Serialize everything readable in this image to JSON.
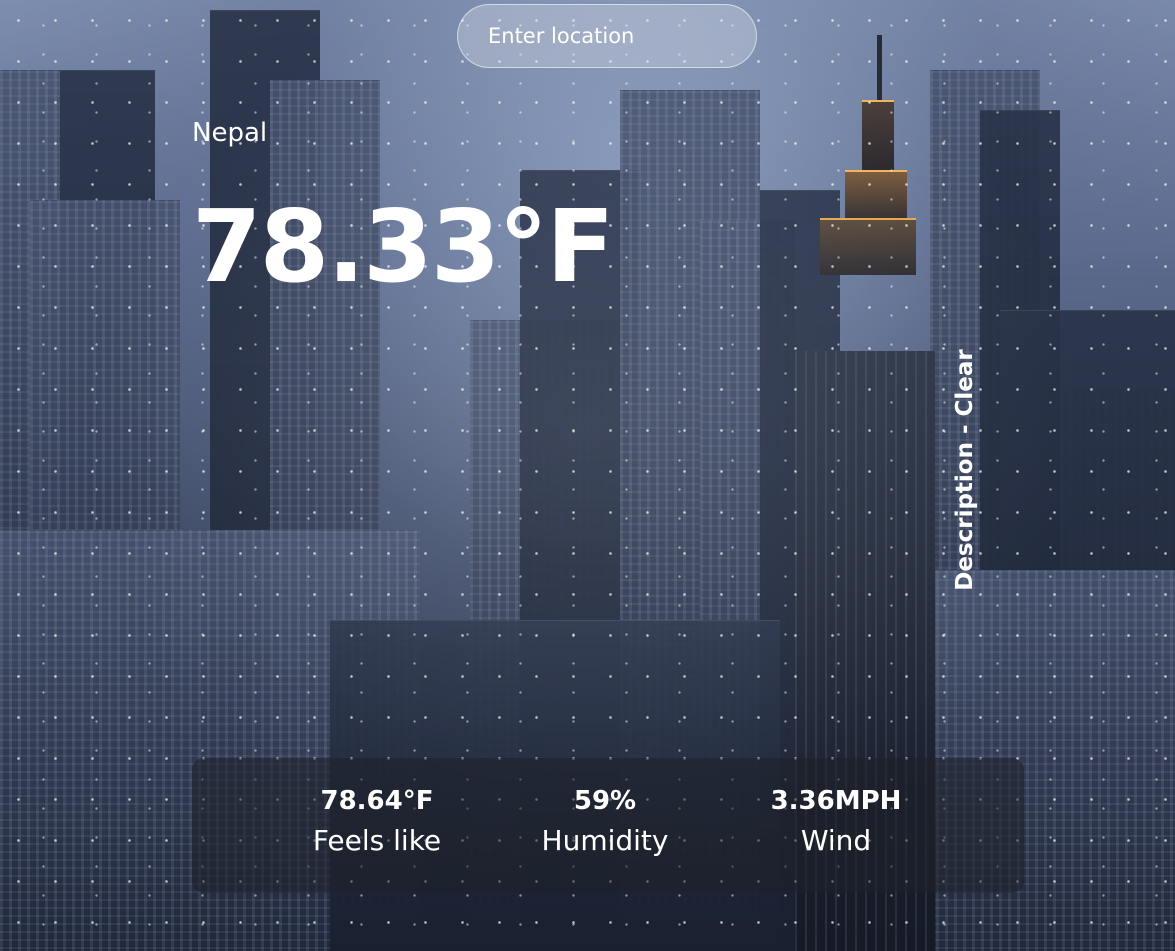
{
  "search": {
    "placeholder": "Enter location",
    "value": ""
  },
  "weather": {
    "location": "Nepal",
    "temperature": "78.33°F",
    "description": "Description - Clear"
  },
  "stats": {
    "feels_like": {
      "value": "78.64°F",
      "label": "Feels like"
    },
    "humidity": {
      "value": "59%",
      "label": "Humidity"
    },
    "wind": {
      "value": "3.36MPH",
      "label": "Wind"
    }
  }
}
